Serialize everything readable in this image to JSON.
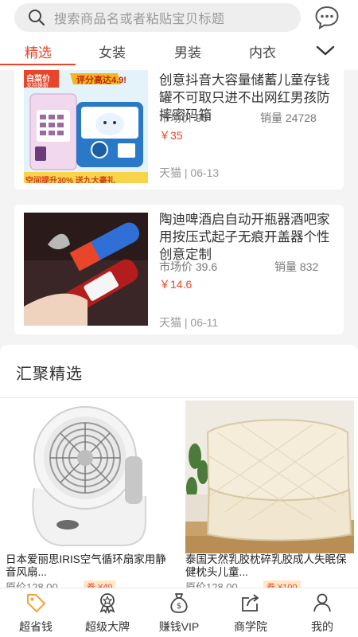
{
  "search": {
    "placeholder": "搜索商品名或者粘贴宝贝标题"
  },
  "tabs": [
    {
      "label": "精选"
    },
    {
      "label": "女装"
    },
    {
      "label": "男装"
    },
    {
      "label": "内衣"
    }
  ],
  "products": [
    {
      "title": "创意抖音大容量储蓄儿童存钱罐不可取只进不出网红男孩防摔密码箱",
      "market_price": "市场价 90",
      "sales": "销量 24728",
      "price": "￥35",
      "shop_date": "天猫 | 06-13",
      "badge_left": "白菜价",
      "badge_left_sub": "支持换新",
      "badge_right": "评分高达4.9!",
      "banner": "空间提升30% 送九大豪礼"
    },
    {
      "title": "陶迪啤酒启自动开瓶器酒吧家用按压式起子无痕开盖器个性创意定制",
      "market_price": "市场价 39.6",
      "sales": "销量 832",
      "price": "￥14.6",
      "shop_date": "天猫 | 06-11"
    }
  ],
  "section": {
    "title": "汇聚精选"
  },
  "grid": [
    {
      "title": "日本爱丽思IRIS空气循环扇家用静音风扇...",
      "market": "原价128.00",
      "coupon": "券 ¥40"
    },
    {
      "title": "泰国天然乳胶枕碎乳胶成人失眠保健枕头儿童...",
      "market": "原价128.00",
      "coupon": "券 ¥100"
    }
  ],
  "nav": [
    {
      "label": "超省钱",
      "icon": "tag-icon"
    },
    {
      "label": "超级大牌",
      "icon": "medal-icon"
    },
    {
      "label": "赚钱VIP",
      "icon": "money-bag-icon"
    },
    {
      "label": "商学院",
      "icon": "share-icon"
    },
    {
      "label": "我的",
      "icon": "user-icon"
    }
  ],
  "colors": {
    "accent": "#e8452a",
    "background": "#f4f4f4"
  }
}
